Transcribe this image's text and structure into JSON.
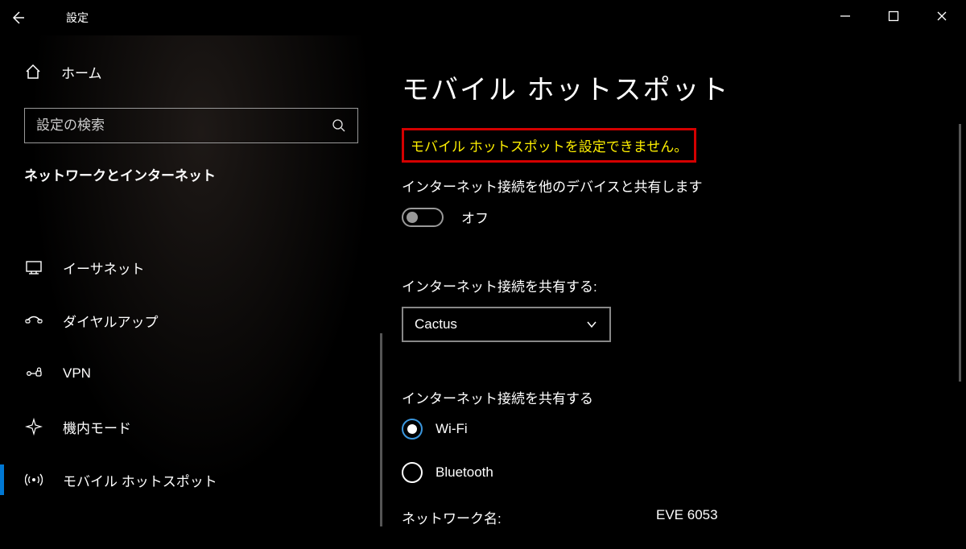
{
  "title_settings": "設定",
  "home_label": "ホーム",
  "search_placeholder": "設定の検索",
  "category": "ネットワークとインターネット",
  "nav": [
    {
      "key": "ethernet",
      "label": "イーサネット"
    },
    {
      "key": "dialup",
      "label": "ダイヤルアップ"
    },
    {
      "key": "vpn",
      "label": "VPN"
    },
    {
      "key": "airplane",
      "label": "機内モード"
    },
    {
      "key": "hotspot",
      "label": "モバイル ホットスポット",
      "selected": true
    }
  ],
  "page_title": "モバイル ホットスポット",
  "error_text": "モバイル ホットスポットを設定できません。",
  "share_subtext": "インターネット接続を他のデバイスと共有します",
  "toggle_state_label": "オフ",
  "select_label": "インターネット接続を共有する:",
  "select_value": "Cactus",
  "radio_label": "インターネット接続を共有する",
  "radio_opt_wifi": "Wi-Fi",
  "radio_opt_bt": "Bluetooth",
  "net_name_label": "ネットワーク名:",
  "net_name_value": "EVE 6053"
}
